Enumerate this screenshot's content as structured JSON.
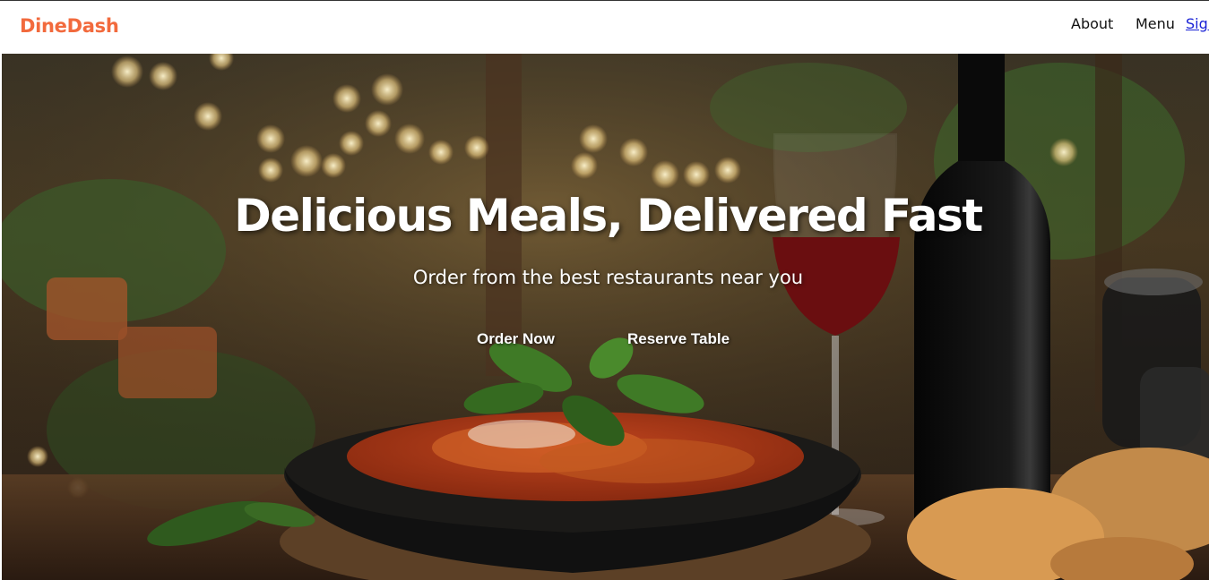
{
  "brand": {
    "name": "DineDash",
    "color": "#f26a3d"
  },
  "nav": {
    "about": "About",
    "menu": "Menu",
    "sign": "Sign"
  },
  "hero": {
    "title": "Delicious Meals, Delivered Fast",
    "subtitle": "Order from the best restaurants near you",
    "order_button": "Order Now",
    "reserve_button": "Reserve Table"
  }
}
